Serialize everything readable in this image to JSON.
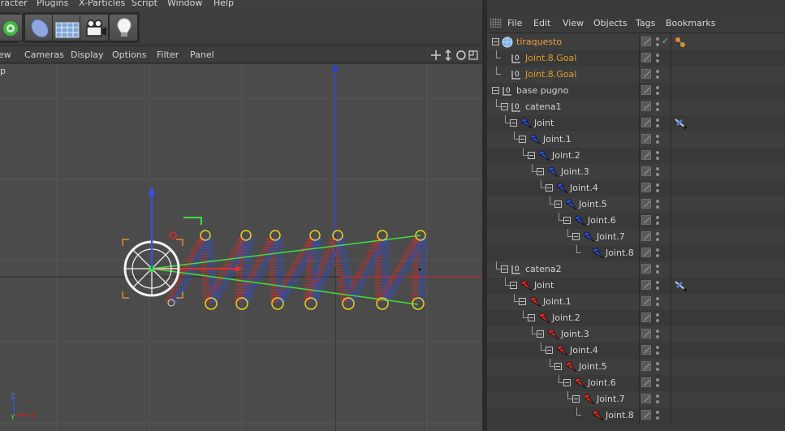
{
  "top_menu": [
    "aracter",
    "Plugins",
    "X-Particles",
    "Script",
    "Window",
    "Help"
  ],
  "toolbar": {
    "buttons": [
      {
        "icon": "deformer-icon"
      },
      {
        "icon": "cube-icon"
      },
      {
        "icon": "floor-grid-icon"
      },
      {
        "icon": "camera-icon"
      },
      {
        "icon": "light-bulb-icon"
      }
    ]
  },
  "viewport_menu": [
    "ew",
    "Cameras",
    "Display",
    "Options",
    "Filter",
    "Panel"
  ],
  "viewport": {
    "label": "p",
    "axis_x_label": "X",
    "axis_y_label": "Y",
    "axis_z_label": "Z"
  },
  "object_manager": {
    "menu": [
      "File",
      "Edit",
      "View",
      "Objects",
      "Tags",
      "Bookmarks"
    ],
    "rows": [
      {
        "name": "tiraquesto",
        "depth": 0,
        "icon": "sphere-object-icon",
        "style": "hl",
        "fold": true,
        "check": true,
        "tag": "material-tag-icon"
      },
      {
        "name": "Joint.8.Goal",
        "depth": 1,
        "icon": "null-object-icon",
        "style": "orange",
        "fold": false
      },
      {
        "name": "Joint.8.Goal",
        "depth": 1,
        "icon": "null-object-icon",
        "style": "orange",
        "fold": false
      },
      {
        "name": "base pugno",
        "depth": 0,
        "icon": "null-object-icon",
        "style": "normal",
        "fold": true
      },
      {
        "name": "catena1",
        "depth": 1,
        "icon": "null-object-icon",
        "style": "normal",
        "fold": true
      },
      {
        "name": "Joint",
        "depth": 2,
        "icon": "joint-blue-icon",
        "style": "normal",
        "fold": true,
        "tag": "ik-tag-icon"
      },
      {
        "name": "Joint.1",
        "depth": 3,
        "icon": "joint-blue-icon",
        "style": "normal",
        "fold": true
      },
      {
        "name": "Joint.2",
        "depth": 4,
        "icon": "joint-blue-icon",
        "style": "normal",
        "fold": true
      },
      {
        "name": "Joint.3",
        "depth": 5,
        "icon": "joint-blue-icon",
        "style": "normal",
        "fold": true
      },
      {
        "name": "Joint.4",
        "depth": 6,
        "icon": "joint-blue-icon",
        "style": "normal",
        "fold": true
      },
      {
        "name": "Joint.5",
        "depth": 7,
        "icon": "joint-blue-icon",
        "style": "normal",
        "fold": true
      },
      {
        "name": "Joint.6",
        "depth": 8,
        "icon": "joint-blue-icon",
        "style": "normal",
        "fold": true
      },
      {
        "name": "Joint.7",
        "depth": 9,
        "icon": "joint-blue-icon",
        "style": "normal",
        "fold": true
      },
      {
        "name": "Joint.8",
        "depth": 10,
        "icon": "joint-blue-icon",
        "style": "normal",
        "fold": false
      },
      {
        "name": "catena2",
        "depth": 1,
        "icon": "null-object-icon",
        "style": "normal",
        "fold": true
      },
      {
        "name": "Joint",
        "depth": 2,
        "icon": "joint-red-icon",
        "style": "normal",
        "fold": true,
        "tag": "ik-tag-icon"
      },
      {
        "name": "Joint.1",
        "depth": 3,
        "icon": "joint-red-icon",
        "style": "normal",
        "fold": true
      },
      {
        "name": "Joint.2",
        "depth": 4,
        "icon": "joint-red-icon",
        "style": "normal",
        "fold": true
      },
      {
        "name": "Joint.3",
        "depth": 5,
        "icon": "joint-red-icon",
        "style": "normal",
        "fold": true
      },
      {
        "name": "Joint.4",
        "depth": 6,
        "icon": "joint-red-icon",
        "style": "normal",
        "fold": true
      },
      {
        "name": "Joint.5",
        "depth": 7,
        "icon": "joint-red-icon",
        "style": "normal",
        "fold": true
      },
      {
        "name": "Joint.6",
        "depth": 8,
        "icon": "joint-red-icon",
        "style": "normal",
        "fold": true
      },
      {
        "name": "Joint.7",
        "depth": 9,
        "icon": "joint-red-icon",
        "style": "normal",
        "fold": true
      },
      {
        "name": "Joint.8",
        "depth": 10,
        "icon": "joint-red-icon",
        "style": "normal",
        "fold": false
      }
    ]
  },
  "colors": {
    "joint_blue": "#2a4fe0",
    "joint_red": "#e02a2a",
    "goal_orange": "#e09a2c",
    "ik_line_green": "#3ee03e",
    "handle_yellow": "#e8d020"
  }
}
